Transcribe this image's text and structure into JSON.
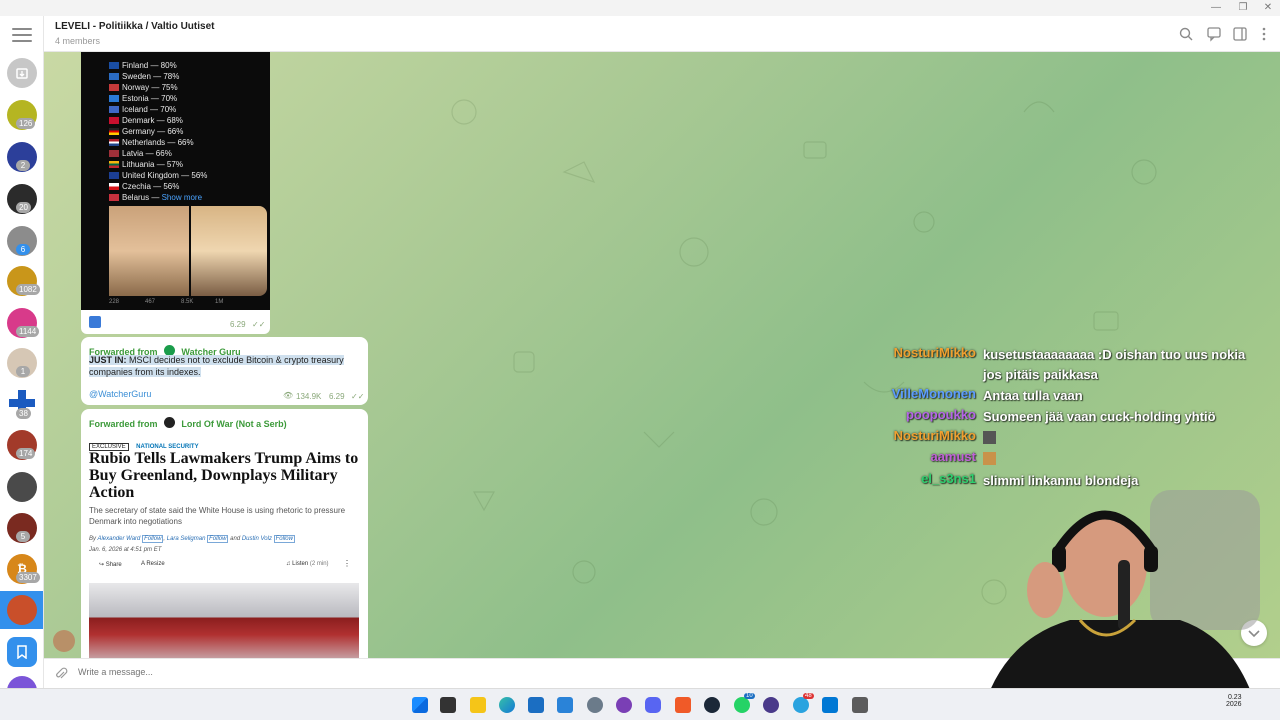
{
  "window": {
    "minimize": "—",
    "maximize": "❐",
    "close": "✕"
  },
  "sidebar": {
    "chats": [
      {
        "icon": "archive-icon",
        "badge": ""
      },
      {
        "icon": "chat-avatar",
        "badge": "126"
      },
      {
        "icon": "chat-avatar",
        "badge": "2"
      },
      {
        "icon": "chat-avatar",
        "badge": "20"
      },
      {
        "icon": "chat-avatar",
        "badge": "6"
      },
      {
        "icon": "chat-avatar",
        "badge": "1082"
      },
      {
        "icon": "chat-avatar",
        "badge": "1144"
      },
      {
        "icon": "chat-avatar",
        "badge": "1"
      },
      {
        "icon": "chat-avatar",
        "badge": "38"
      },
      {
        "icon": "chat-avatar",
        "badge": "174"
      },
      {
        "icon": "chat-avatar",
        "badge": ""
      },
      {
        "icon": "chat-avatar",
        "badge": "5"
      },
      {
        "icon": "chat-avatar",
        "badge": "3307"
      },
      {
        "icon": "chat-avatar-active",
        "badge": ""
      },
      {
        "icon": "bookmark-icon",
        "badge": ""
      }
    ]
  },
  "header": {
    "title": "LEVELI - Politiikka / Valtio Uutiset",
    "members": "4 members"
  },
  "tweet": {
    "lines": [
      "Finland — 80%",
      "Sweden — 78%",
      "Norway — 75%",
      "Estonia — 70%",
      "Iceland — 70%",
      "Denmark — 68%",
      "Germany — 66%",
      "Netherlands — 66%",
      "Latvia — 66%",
      "Lithuania — 57%",
      "United Kingdom — 56%",
      "Czechia — 56%"
    ],
    "last_line": "Belarus — ",
    "show_more": "Show more",
    "flag_colors": [
      "#1a4ea3",
      "#2a6bc2",
      "#c63a3a",
      "#2a7ad6",
      "#3f68c5",
      "#c8102e",
      "#222222",
      "#ae1c28",
      "#9e3039",
      "#f6b40e",
      "#1c3f94",
      "#d7141a",
      "#c8313e"
    ],
    "actions": {
      "replies": "228",
      "reposts": "467",
      "likes": "8.5K",
      "views": "1M"
    },
    "time": "6.29",
    "check": "✓✓"
  },
  "message1": {
    "forwarded_label": "Forwarded from",
    "source": "Watcher Guru",
    "bold": "JUST IN:",
    "text": " MSCI decides not to exclude Bitcoin & crypto treasury companies from its indexes.",
    "link": "@WatcherGuru",
    "views": "134.9K",
    "time": "6.29",
    "check": "✓✓"
  },
  "message2": {
    "forwarded_label": "Forwarded from",
    "source": "Lord Of War (Not a Serb)",
    "tag": "EXCLUSIVE",
    "section": "NATIONAL SECURITY",
    "headline": "Rubio Tells Lawmakers Trump Aims to Buy Greenland, Downplays Military Action",
    "subhead": "The secretary of state said the White House is using rhetoric to pressure Denmark into negotiations",
    "byline_prefix": "By",
    "author1": "Alexander Ward",
    "author2": "Lara Seligman",
    "author3_prefix": "and",
    "author3": "Dustin Volz",
    "follow": "Follow",
    "date": "Jan. 6, 2026 at 4:51 pm ET",
    "share": "Share",
    "resize": "Resize",
    "listen": "Listen",
    "listen_time": "(2 min)"
  },
  "composer": {
    "placeholder": "Write a message..."
  },
  "overlay": {
    "messages": [
      {
        "name": "NosturiMikko",
        "color": "#f0a030",
        "text": "kusetustaaaaaaaa :D oishan tuo uus nokia jos pitäis paikkasa"
      },
      {
        "name": "VilleMononen",
        "color": "#5b9bff",
        "text": "Antaa tulla vaan"
      },
      {
        "name": "poopoukko",
        "color": "#b565e8",
        "text": "Suomeen jää vaan cuck-holding yhtiö"
      },
      {
        "name": "NosturiMikko",
        "color": "#f0a030",
        "text": ""
      },
      {
        "name": "aamust",
        "color": "#c060d8",
        "text": ""
      },
      {
        "name": "el_s3ns1",
        "color": "#2fd06f",
        "text": "slimmi linkannu blondeja"
      }
    ]
  },
  "taskbar": {
    "time": "0.23",
    "date": "2026",
    "badge_discord": "10",
    "badge_tg": "48"
  }
}
